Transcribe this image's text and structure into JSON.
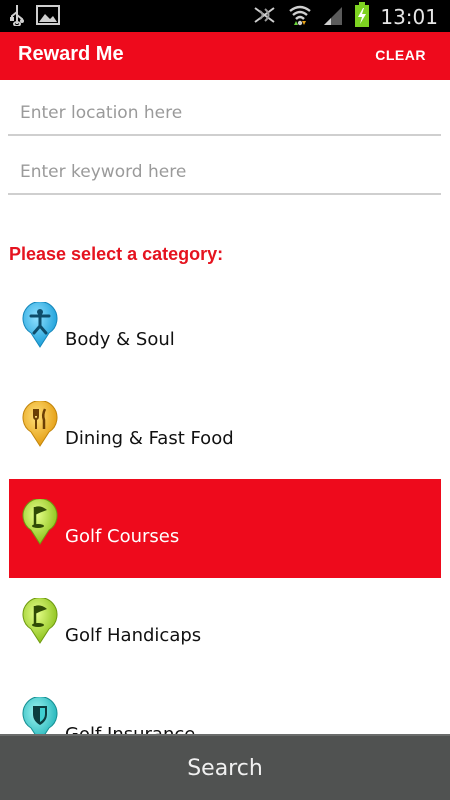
{
  "status_bar": {
    "time": "13:01",
    "left_icons": [
      "usb-icon",
      "image-icon"
    ],
    "right_icons": [
      "mute-icon",
      "wifi-icon",
      "signal-icon",
      "battery-charging-icon"
    ]
  },
  "app_bar": {
    "title": "Reward Me",
    "clear_label": "CLEAR",
    "color": "#ee0a1c"
  },
  "inputs": {
    "location": {
      "placeholder": "Enter location here",
      "value": ""
    },
    "keyword": {
      "placeholder": "Enter keyword here",
      "value": ""
    }
  },
  "category_prompt": "Please select a category:",
  "categories": [
    {
      "label": "Body & Soul",
      "icon": "person-icon",
      "pin_color": "#2bb3e8",
      "selected": false
    },
    {
      "label": "Dining & Fast Food",
      "icon": "cutlery-icon",
      "pin_color": "#f0b21c",
      "selected": false
    },
    {
      "label": "Golf Courses",
      "icon": "golf-flag-icon",
      "pin_color": "#9ccc1c",
      "selected": true
    },
    {
      "label": "Golf Handicaps",
      "icon": "golf-flag-icon",
      "pin_color": "#9ccc1c",
      "selected": false
    },
    {
      "label": "Golf Insurance",
      "icon": "shield-icon",
      "pin_color": "#2bc6c9",
      "selected": false
    }
  ],
  "search_button": {
    "label": "Search"
  }
}
